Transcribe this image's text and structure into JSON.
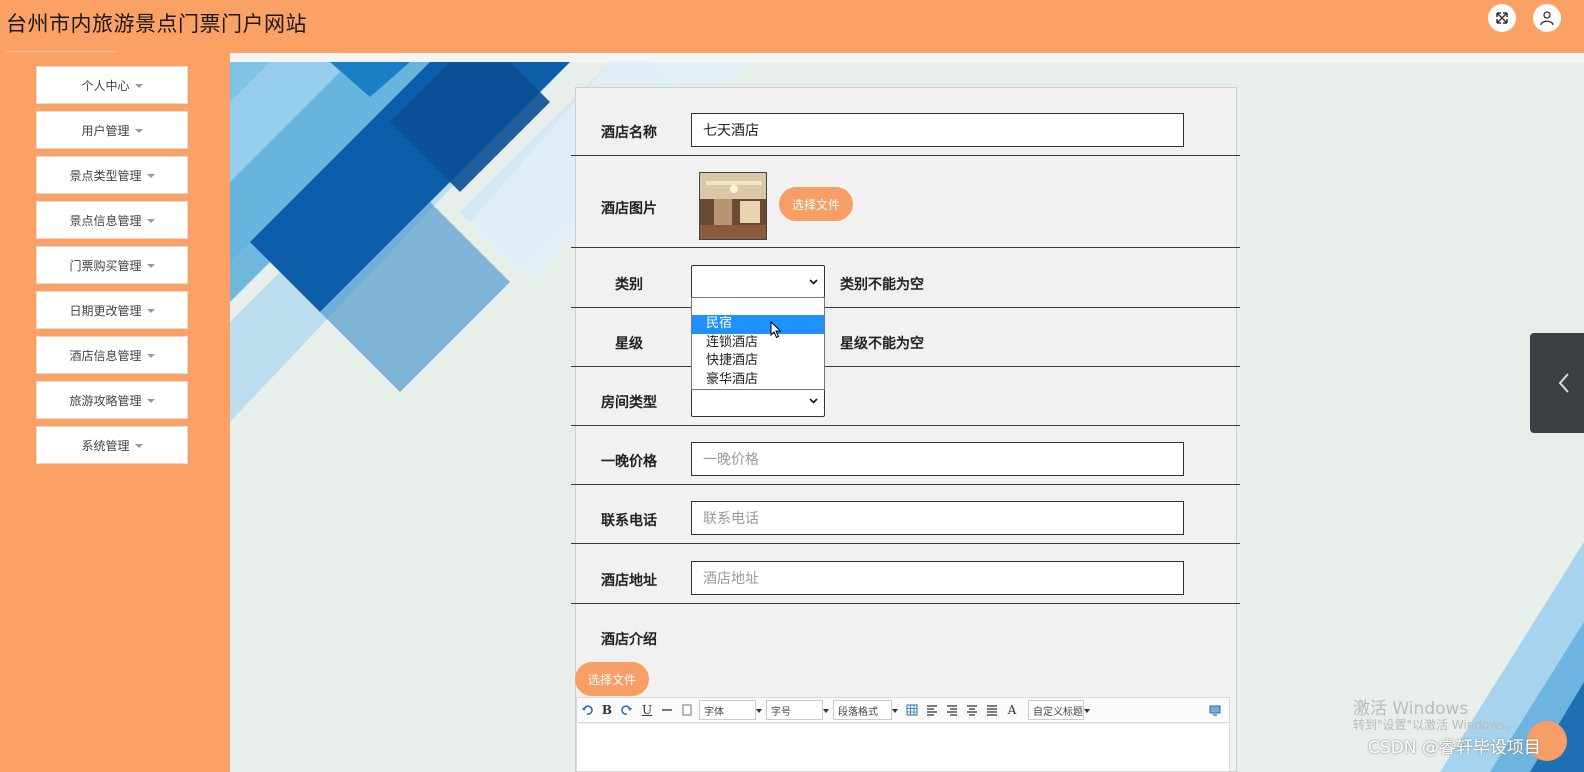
{
  "header": {
    "title": "台州市内旅游景点门票门户网站",
    "icons": [
      "expand-icon",
      "user-icon"
    ],
    "colors": {
      "accent": "#fca165"
    }
  },
  "sidebar": {
    "items": [
      {
        "label": "个人中心"
      },
      {
        "label": "用户管理"
      },
      {
        "label": "景点类型管理"
      },
      {
        "label": "景点信息管理"
      },
      {
        "label": "门票购买管理"
      },
      {
        "label": "日期更改管理"
      },
      {
        "label": "酒店信息管理"
      },
      {
        "label": "旅游攻略管理"
      },
      {
        "label": "系统管理"
      }
    ]
  },
  "form": {
    "name": {
      "label": "酒店名称",
      "value": "七天酒店"
    },
    "image": {
      "label": "酒店图片",
      "button": "选择文件"
    },
    "category": {
      "label": "类别",
      "value": "",
      "error": "类别不能为空",
      "options": [
        "",
        "民宿",
        "连锁酒店",
        "快捷酒店",
        "豪华酒店"
      ],
      "highlighted": "民宿"
    },
    "star": {
      "label": "星级",
      "error": "星级不能为空"
    },
    "room_type": {
      "label": "房间类型"
    },
    "price": {
      "label": "一晚价格",
      "placeholder": "一晚价格"
    },
    "phone": {
      "label": "联系电话",
      "placeholder": "联系电话"
    },
    "address": {
      "label": "酒店地址",
      "placeholder": "酒店地址"
    },
    "intro": {
      "label": "酒店介绍",
      "button": "选择文件"
    }
  },
  "editor": {
    "font_label": "字体",
    "size_label": "字号",
    "paragraph_label": "段落格式",
    "custom_title_label": "自定义标题",
    "bold": "B",
    "underline": "U",
    "font_color": "A"
  },
  "watermark": {
    "windows_line1": "激活 Windows",
    "windows_line2": "转到\"设置\"以激活 Windows。",
    "csdn": "CSDN @睿轩毕设项目"
  }
}
